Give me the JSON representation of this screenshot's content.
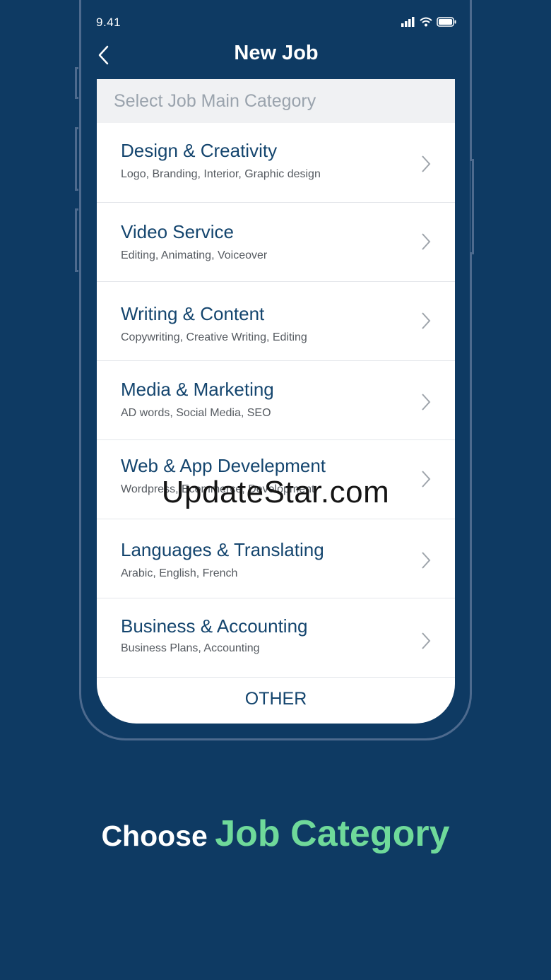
{
  "status": {
    "time": "9.41"
  },
  "navbar": {
    "title": "New Job",
    "back_icon": "chevron-left-icon"
  },
  "card": {
    "header": "Select Job Main Category",
    "categories": [
      {
        "title": "Design & Creativity",
        "subtitle": "Logo, Branding, Interior, Graphic design"
      },
      {
        "title": "Video Service",
        "subtitle": "Editing, Animating, Voiceover"
      },
      {
        "title": "Writing & Content",
        "subtitle": "Copywriting, Creative Writing, Editing"
      },
      {
        "title": "Media & Marketing",
        "subtitle": "AD words, Social Media, SEO"
      },
      {
        "title": "Web & App Develepment",
        "subtitle": "Wordpress, Ecommerce, Development"
      },
      {
        "title": "Languages & Translating",
        "subtitle": "Arabic, English, French"
      },
      {
        "title": "Business & Accounting",
        "subtitle": "Business Plans, Accounting"
      }
    ],
    "other_label": "OTHER"
  },
  "watermark": "UpdateStar.com",
  "caption": {
    "part1": "Choose",
    "part2": "Job Category"
  },
  "colors": {
    "background": "#0e3a63",
    "category_title": "#14456e",
    "accent_green": "#6fd99a",
    "phone_outline": "#4d6a8e"
  }
}
